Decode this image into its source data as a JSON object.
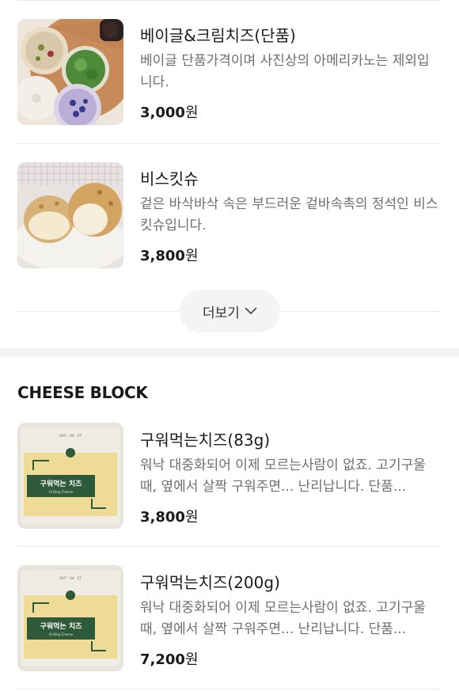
{
  "top_items": [
    {
      "name": "베이글&크림치즈(단품)",
      "description": "베이글 단품가격이며 사진상의 아메리카노는 제외입니다.",
      "price": "3,000",
      "unit": "원"
    },
    {
      "name": "비스킷슈",
      "description": "겉은 바삭바삭 속은 부드러운 겉바속촉의 정석인 비스킷슈입니다.",
      "price": "3,800",
      "unit": "원"
    }
  ],
  "more_button": {
    "label": "더보기",
    "icon": "chevron-down-icon"
  },
  "section": {
    "title": "CHEESE BLOCK"
  },
  "cheese_items": [
    {
      "name": "구워먹는치즈(83g)",
      "description": "워낙 대중화되어 이제 모르는사람이 없죠. 고기구울때, 옆에서 살짝 구워주면... 난리납니다. 단품...",
      "price": "3,800",
      "unit": "원",
      "package_label": "구워먹는 치즈",
      "package_sublabel": "Grilling Cheese"
    },
    {
      "name": "구워먹는치즈(200g)",
      "description": "워낙 대중화되어 이제 모르는사람이 없죠. 고기구울때, 옆에서 살짝 구워주면... 난리납니다. 단품...",
      "price": "7,200",
      "unit": "원",
      "package_label": "구워먹는 치즈",
      "package_sublabel": "Grilling Cheese"
    }
  ]
}
